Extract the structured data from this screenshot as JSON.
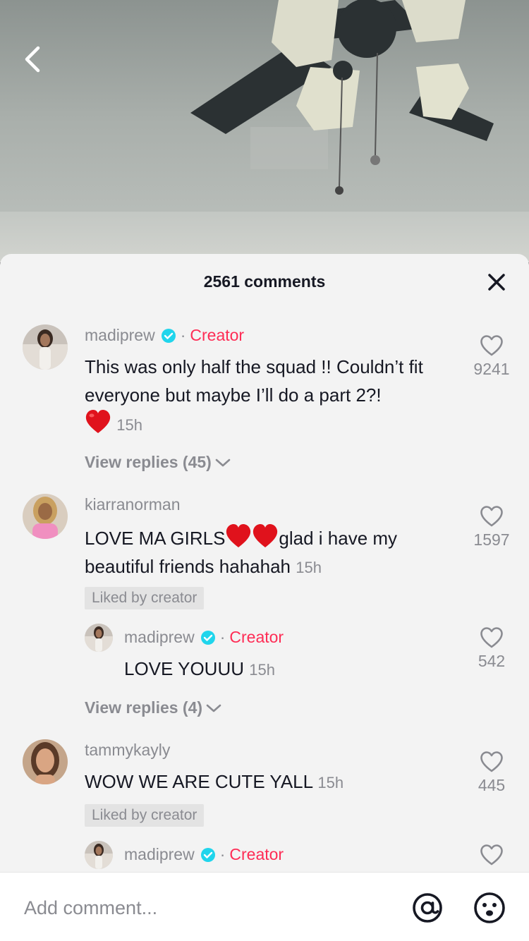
{
  "header": {
    "comment_count_label": "2561 comments"
  },
  "comments": [
    {
      "username": "madiprew",
      "verified": true,
      "role": "Creator",
      "separator": "·",
      "text": "This was only half the squad !! Couldn’t fit everyone but maybe I’ll do a part 2?!",
      "time": "15h",
      "likes": "9241",
      "view_replies": "View replies (45)"
    },
    {
      "username": "kiarranorman",
      "text_before": "LOVE MA GIRLS",
      "text_after": "glad i have my beautiful friends hahahah",
      "time": "15h",
      "likes": "1597",
      "badge": "Liked by creator",
      "reply": {
        "username": "madiprew",
        "role": "Creator",
        "separator": "·",
        "text": "LOVE YOUUU",
        "time": "15h",
        "likes": "542"
      },
      "view_replies": "View replies (4)"
    },
    {
      "username": "tammykayly",
      "text": "WOW WE ARE CUTE YALL",
      "time": "15h",
      "likes": "445",
      "badge": "Liked by creator",
      "reply": {
        "username": "madiprew",
        "role": "Creator",
        "separator": "·"
      }
    }
  ],
  "composer": {
    "placeholder": "Add comment..."
  },
  "colors": {
    "accent": "#fe2c55",
    "verified": "#20d5ec",
    "sheet_bg": "#f3f3f3",
    "muted_text": "#8a8b91"
  },
  "icons": [
    "back-icon",
    "close-icon",
    "verified-icon",
    "heart-outline-icon",
    "red-heart-emoji",
    "chevron-down-icon",
    "at-icon",
    "emoji-icon"
  ]
}
